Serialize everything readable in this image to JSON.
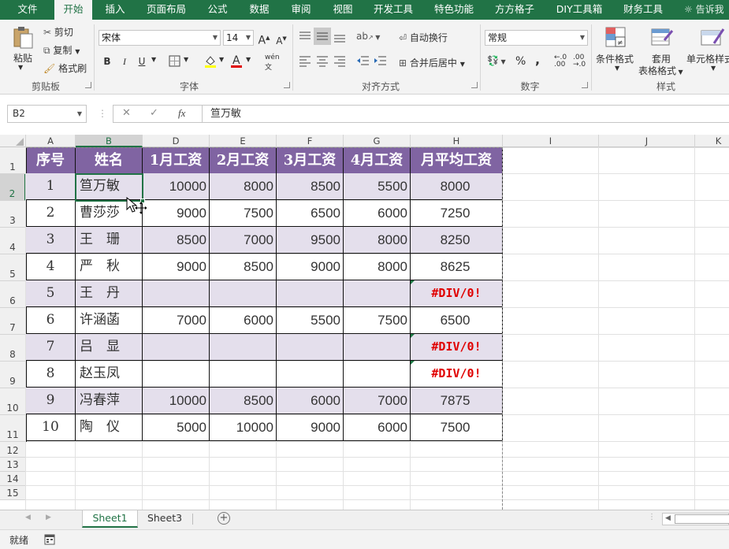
{
  "ribbon_tabs": [
    "文件",
    "开始",
    "插入",
    "页面布局",
    "公式",
    "数据",
    "审阅",
    "视图",
    "开发工具",
    "特色功能",
    "方方格子",
    "DIY工具箱",
    "财务工具"
  ],
  "tell_me": "告诉我",
  "clipboard": {
    "paste": "粘贴",
    "cut": "剪切",
    "copy": "复制",
    "format_painter": "格式刷",
    "label": "剪贴板"
  },
  "font": {
    "name": "宋体",
    "size": "14",
    "bold": "B",
    "italic": "I",
    "underline": "U",
    "label": "字体"
  },
  "alignment": {
    "wrap": "自动换行",
    "merge": "合并后居中",
    "label": "对齐方式"
  },
  "number": {
    "format": "常规",
    "percent": "%",
    "comma": ",",
    "label": "数字"
  },
  "styles": {
    "conditional": "条件格式",
    "table_line1": "套用",
    "table_line2": "表格格式",
    "cell_style": "单元格样式",
    "label": "样式"
  },
  "formula_bar": {
    "name_box": "B2",
    "fx": "fx",
    "value": "笪万敏"
  },
  "columns": [
    "A",
    "B",
    "D",
    "E",
    "F",
    "G",
    "H",
    "I",
    "J",
    "K"
  ],
  "rows": [
    "1",
    "2",
    "3",
    "4",
    "5",
    "6",
    "7",
    "8",
    "9",
    "10",
    "11",
    "12",
    "13",
    "14",
    "15"
  ],
  "table": {
    "headers": [
      "序号",
      "姓名",
      "1月工资",
      "2月工资",
      "3月工资",
      "4月工资",
      "月平均工资"
    ],
    "rows": [
      [
        "1",
        "笪万敏",
        "10000",
        "8000",
        "8500",
        "5500",
        "8000"
      ],
      [
        "2",
        "曹莎莎",
        "9000",
        "7500",
        "6500",
        "6000",
        "7250"
      ],
      [
        "3",
        "王　珊",
        "8500",
        "7000",
        "9500",
        "8000",
        "8250"
      ],
      [
        "4",
        "严　秋",
        "9000",
        "8500",
        "9000",
        "8000",
        "8625"
      ],
      [
        "5",
        "王　丹",
        "",
        "",
        "",
        "",
        "#DIV/0!"
      ],
      [
        "6",
        "许涵菡",
        "7000",
        "6000",
        "5500",
        "7500",
        "6500"
      ],
      [
        "7",
        "吕　显",
        "",
        "",
        "",
        "",
        "#DIV/0!"
      ],
      [
        "8",
        "赵玉凤",
        "",
        "",
        "",
        "",
        "#DIV/0!"
      ],
      [
        "9",
        "冯春萍",
        "10000",
        "8500",
        "6000",
        "7000",
        "7875"
      ],
      [
        "10",
        "陶　仪",
        "5000",
        "10000",
        "9000",
        "6000",
        "7500"
      ]
    ]
  },
  "sheet_tabs": [
    "Sheet1",
    "Sheet3"
  ],
  "status_text": "就绪",
  "colors": {
    "accent": "#217346",
    "header_fill": "#8064a2",
    "band_fill": "#e4dfec",
    "error": "#e00000"
  }
}
